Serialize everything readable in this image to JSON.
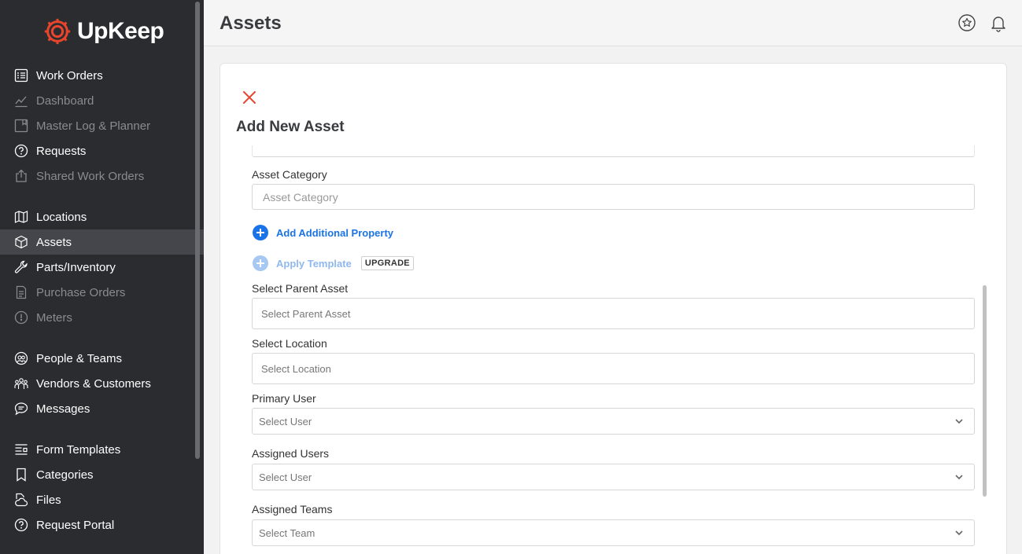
{
  "app": {
    "name": "UpKeep",
    "brand_color": "#e8452c"
  },
  "sidebar": {
    "items": [
      {
        "label": "Work Orders",
        "icon": "list-icon",
        "disabled": false
      },
      {
        "label": "Dashboard",
        "icon": "chart-line-icon",
        "disabled": true
      },
      {
        "label": "Master Log & Planner",
        "icon": "planner-icon",
        "disabled": true
      },
      {
        "label": "Requests",
        "icon": "question-circle-icon",
        "disabled": false
      },
      {
        "label": "Shared Work Orders",
        "icon": "share-icon",
        "disabled": true
      },
      {
        "label": "Locations",
        "icon": "map-icon",
        "disabled": false
      },
      {
        "label": "Assets",
        "icon": "cube-icon",
        "disabled": false,
        "active": true
      },
      {
        "label": "Parts/Inventory",
        "icon": "wrench-icon",
        "disabled": false
      },
      {
        "label": "Purchase Orders",
        "icon": "document-icon",
        "disabled": true
      },
      {
        "label": "Meters",
        "icon": "gauge-icon",
        "disabled": true
      },
      {
        "label": "People & Teams",
        "icon": "people-icon",
        "disabled": false
      },
      {
        "label": "Vendors & Customers",
        "icon": "group-icon",
        "disabled": false
      },
      {
        "label": "Messages",
        "icon": "chat-icon",
        "disabled": false
      },
      {
        "label": "Form Templates",
        "icon": "form-icon",
        "disabled": false
      },
      {
        "label": "Categories",
        "icon": "bookmark-icon",
        "disabled": false
      },
      {
        "label": "Files",
        "icon": "cloud-file-icon",
        "disabled": false
      },
      {
        "label": "Request Portal",
        "icon": "question-circle-icon",
        "disabled": false
      }
    ]
  },
  "header": {
    "title": "Assets",
    "icons": [
      "star-icon",
      "bell-icon"
    ]
  },
  "form": {
    "title": "Add New Asset",
    "asset_category_label": "Asset Category",
    "asset_category_placeholder": "Asset Category",
    "add_property_label": "Add Additional Property",
    "apply_template_label": "Apply Template",
    "upgrade_badge": "UPGRADE",
    "parent_asset_label": "Select Parent Asset",
    "parent_asset_placeholder": "Select Parent Asset",
    "location_label": "Select Location",
    "location_placeholder": "Select Location",
    "primary_user_label": "Primary User",
    "primary_user_placeholder": "Select User",
    "assigned_users_label": "Assigned Users",
    "assigned_users_placeholder": "Select User",
    "assigned_teams_label": "Assigned Teams",
    "assigned_teams_placeholder": "Select Team",
    "accent_color": "#1a73e8",
    "close_color": "#e8452c"
  }
}
